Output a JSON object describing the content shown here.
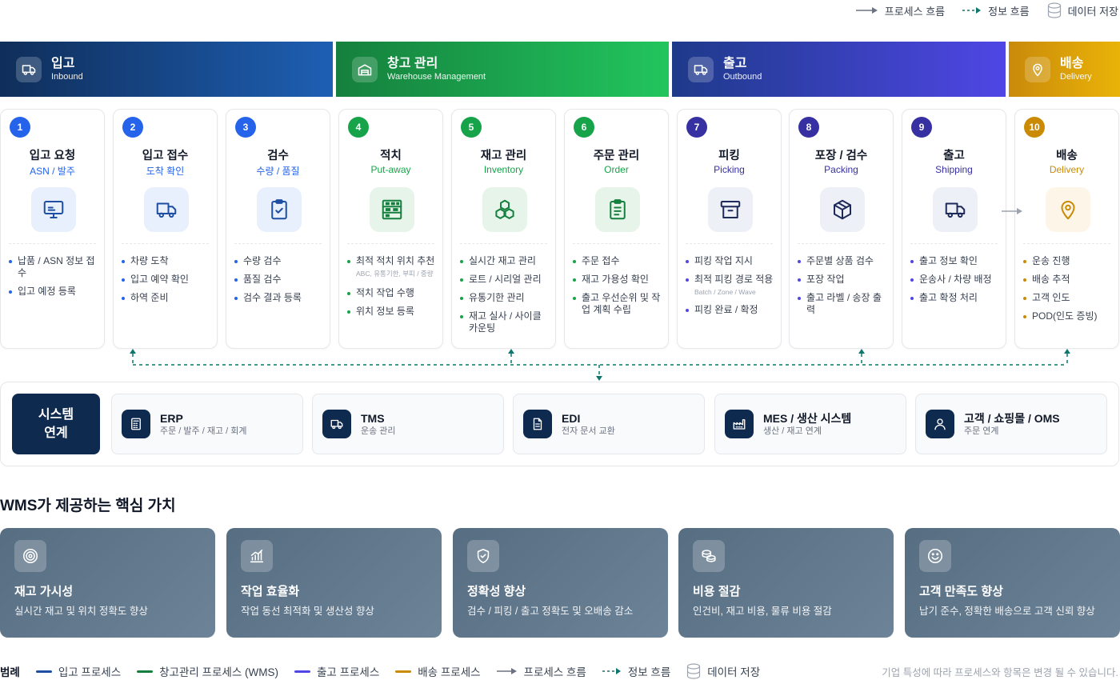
{
  "top_legend": {
    "process_flow": "프로세스 흐름",
    "info_flow": "정보 흐름",
    "data_store": "데이터 저장"
  },
  "phases": [
    {
      "title": "입고",
      "subtitle": "Inbound",
      "color_from": "#0f2e5a",
      "color_to": "#1e5fb3",
      "icon": "truck-icon"
    },
    {
      "title": "창고 관리",
      "subtitle": "Warehouse Management",
      "color_from": "#15803d",
      "color_to": "#22c55e",
      "icon": "warehouse-icon"
    },
    {
      "title": "출고",
      "subtitle": "Outbound",
      "color_from": "#1e3a8a",
      "color_to": "#4f46e5",
      "icon": "truck-icon"
    },
    {
      "title": "배송",
      "subtitle": "Delivery",
      "color_from": "#c98a0a",
      "color_to": "#eab308",
      "icon": "location-pin-icon"
    }
  ],
  "steps": [
    {
      "num": "1",
      "title": "입고 요청",
      "subtitle": "ASN / 발주",
      "accent": "#2563eb",
      "icon": "monitor-icon",
      "items": [
        {
          "text": "납품 / ASN 정보 접수"
        },
        {
          "text": "입고 예정 등록"
        }
      ]
    },
    {
      "num": "2",
      "title": "입고 접수",
      "subtitle": "도착 확인",
      "accent": "#2563eb",
      "icon": "truck-icon",
      "items": [
        {
          "text": "차량 도착"
        },
        {
          "text": "입고 예약 확인"
        },
        {
          "text": "하역 준비"
        }
      ]
    },
    {
      "num": "3",
      "title": "검수",
      "subtitle": "수량 / 품질",
      "accent": "#2563eb",
      "icon": "clipboard-check-icon",
      "items": [
        {
          "text": "수량 검수"
        },
        {
          "text": "품질 검수"
        },
        {
          "text": "검수 결과 등록"
        }
      ]
    },
    {
      "num": "4",
      "title": "적치",
      "subtitle": "Put-away",
      "accent": "#16a34a",
      "icon": "shelves-icon",
      "items": [
        {
          "text": "최적 적치 위치 추천",
          "note": "ABC, 유통기한, 부피 / 중량"
        },
        {
          "text": "적치 작업 수행"
        },
        {
          "text": "위치 정보 등록"
        }
      ]
    },
    {
      "num": "5",
      "title": "재고 관리",
      "subtitle": "Inventory",
      "accent": "#16a34a",
      "icon": "boxes-icon",
      "items": [
        {
          "text": "실시간 재고 관리"
        },
        {
          "text": "로트 / 시리얼 관리"
        },
        {
          "text": "유통기한 관리"
        },
        {
          "text": "재고 실사 / 사이클 카운팅"
        }
      ]
    },
    {
      "num": "6",
      "title": "주문 관리",
      "subtitle": "Order",
      "accent": "#16a34a",
      "icon": "clipboard-list-icon",
      "items": [
        {
          "text": "주문 접수"
        },
        {
          "text": "재고 가용성 확인"
        },
        {
          "text": "출고 우선순위 및 작업 계획 수립"
        }
      ]
    },
    {
      "num": "7",
      "title": "피킹",
      "subtitle": "Picking",
      "accent": "#3730a3",
      "icon": "archive-box-icon",
      "items": [
        {
          "text": "피킹 작업 지시"
        },
        {
          "text": "최적 피킹 경로 적용",
          "note": "Batch / Zone / Wave"
        },
        {
          "text": "피킹 완료 / 확정"
        }
      ]
    },
    {
      "num": "8",
      "title": "포장 / 검수",
      "subtitle": "Packing",
      "accent": "#3730a3",
      "icon": "package-icon",
      "items": [
        {
          "text": "주문별 상품 검수"
        },
        {
          "text": "포장 작업"
        },
        {
          "text": "출고 라벨 / 송장 출력"
        }
      ]
    },
    {
      "num": "9",
      "title": "출고",
      "subtitle": "Shipping",
      "accent": "#3730a3",
      "icon": "truck-icon",
      "items": [
        {
          "text": "출고 정보 확인"
        },
        {
          "text": "운송사 / 차량 배정"
        },
        {
          "text": "출고 확정 처리"
        }
      ]
    },
    {
      "num": "10",
      "title": "배송",
      "subtitle": "Delivery",
      "accent": "#ca8a04",
      "icon": "location-pin-icon",
      "items": [
        {
          "text": "운송 진행"
        },
        {
          "text": "배송 추적"
        },
        {
          "text": "고객 인도"
        },
        {
          "text": "POD(인도 증빙)"
        }
      ]
    }
  ],
  "system": {
    "label": "시스템 연계",
    "items": [
      {
        "title": "ERP",
        "desc": "주문 / 발주 / 재고 / 회계",
        "icon": "calculator-icon"
      },
      {
        "title": "TMS",
        "desc": "운송 관리",
        "icon": "truck-icon"
      },
      {
        "title": "EDI",
        "desc": "전자 문서 교환",
        "icon": "document-icon"
      },
      {
        "title": "MES / 생산 시스템",
        "desc": "생산 / 재고 연계",
        "icon": "factory-icon"
      },
      {
        "title": "고객 / 쇼핑몰 / OMS",
        "desc": "주문 연계",
        "icon": "user-icon"
      }
    ]
  },
  "values": {
    "title": "WMS가 제공하는 핵심 가치",
    "cards": [
      {
        "title": "재고 가시성",
        "desc": "실시간 재고 및 위치 정확도 향상",
        "icon": "target-icon"
      },
      {
        "title": "작업 효율화",
        "desc": "작업 동선 최적화 및 생산성 향상",
        "icon": "bar-chart-icon"
      },
      {
        "title": "정확성 향상",
        "desc": "검수 / 피킹 / 출고 정확도 및 오배송 감소",
        "icon": "shield-check-icon"
      },
      {
        "title": "비용 절감",
        "desc": "인건비, 재고 비용, 물류 비용 절감",
        "icon": "coins-icon"
      },
      {
        "title": "고객 만족도 향상",
        "desc": "납기 준수, 정확한 배송으로 고객 신뢰 향상",
        "icon": "smile-icon"
      }
    ]
  },
  "bottom_legend": {
    "label": "범례",
    "items": [
      {
        "text": "입고 프로세스",
        "color": "#1e4fa3"
      },
      {
        "text": "창고관리 프로세스 (WMS)",
        "color": "#15803d"
      },
      {
        "text": "출고 프로세스",
        "color": "#4f46e5"
      },
      {
        "text": "배송 프로세스",
        "color": "#ca8a04"
      }
    ],
    "process_flow": "프로세스 흐름",
    "info_flow": "정보 흐름",
    "data_store": "데이터 저장",
    "note": "기업 특성에 따라 프로세스와 항목은 변경 될 수 있습니다."
  }
}
